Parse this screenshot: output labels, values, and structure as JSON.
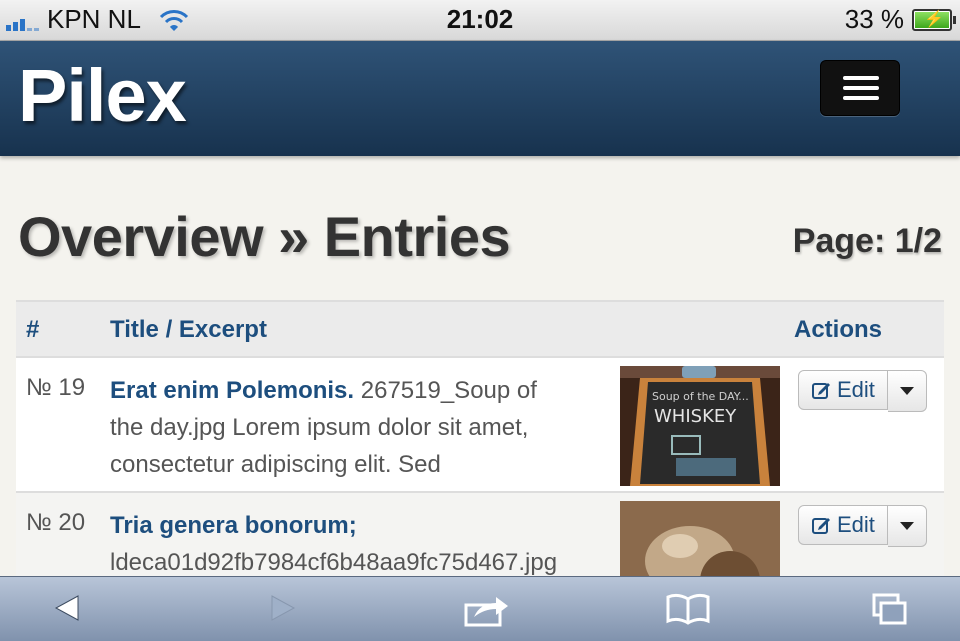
{
  "status_bar": {
    "carrier": "KPN NL",
    "time": "21:02",
    "battery": "33 %"
  },
  "header": {
    "brand": "Pilex",
    "menu_icon": "hamburger-icon"
  },
  "main": {
    "title": "Overview » Entries",
    "page_info": "Page: 1/2"
  },
  "table": {
    "columns": [
      "#",
      "Title / Excerpt",
      "Actions"
    ],
    "rows": [
      {
        "number": "№ 19",
        "title": "Erat enim Polemonis.",
        "excerpt_line1": " 267519_Soup of",
        "excerpt_line2": "the day.jpg Lorem ipsum dolor sit amet,",
        "excerpt_line3": "consectetur adipiscing elit. Sed",
        "edit_label": "Edit"
      },
      {
        "number": "№ 20",
        "title": "Tria genera bonorum;",
        "excerpt_line1": "",
        "excerpt_line2": "ldeca01d92fb7984cf6b48aa9fc75d467.jpg",
        "excerpt_line3": "",
        "edit_label": "Edit"
      }
    ]
  },
  "toolbar": {
    "icons": [
      "back-arrow-icon",
      "forward-arrow-icon",
      "share-icon",
      "bookmarks-icon",
      "tabs-icon"
    ]
  },
  "colors": {
    "accent": "#1d4e7e",
    "header_bg": "#21405f"
  }
}
